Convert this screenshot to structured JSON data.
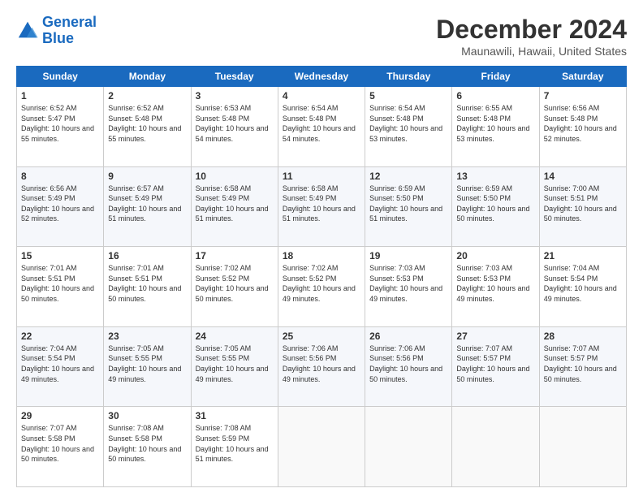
{
  "header": {
    "logo_line1": "General",
    "logo_line2": "Blue",
    "month_title": "December 2024",
    "location": "Maunawili, Hawaii, United States"
  },
  "days_of_week": [
    "Sunday",
    "Monday",
    "Tuesday",
    "Wednesday",
    "Thursday",
    "Friday",
    "Saturday"
  ],
  "weeks": [
    [
      {
        "day": "1",
        "sunrise": "6:52 AM",
        "sunset": "5:47 PM",
        "daylight": "10 hours and 55 minutes."
      },
      {
        "day": "2",
        "sunrise": "6:52 AM",
        "sunset": "5:48 PM",
        "daylight": "10 hours and 55 minutes."
      },
      {
        "day": "3",
        "sunrise": "6:53 AM",
        "sunset": "5:48 PM",
        "daylight": "10 hours and 54 minutes."
      },
      {
        "day": "4",
        "sunrise": "6:54 AM",
        "sunset": "5:48 PM",
        "daylight": "10 hours and 54 minutes."
      },
      {
        "day": "5",
        "sunrise": "6:54 AM",
        "sunset": "5:48 PM",
        "daylight": "10 hours and 53 minutes."
      },
      {
        "day": "6",
        "sunrise": "6:55 AM",
        "sunset": "5:48 PM",
        "daylight": "10 hours and 53 minutes."
      },
      {
        "day": "7",
        "sunrise": "6:56 AM",
        "sunset": "5:48 PM",
        "daylight": "10 hours and 52 minutes."
      }
    ],
    [
      {
        "day": "8",
        "sunrise": "6:56 AM",
        "sunset": "5:49 PM",
        "daylight": "10 hours and 52 minutes."
      },
      {
        "day": "9",
        "sunrise": "6:57 AM",
        "sunset": "5:49 PM",
        "daylight": "10 hours and 51 minutes."
      },
      {
        "day": "10",
        "sunrise": "6:58 AM",
        "sunset": "5:49 PM",
        "daylight": "10 hours and 51 minutes."
      },
      {
        "day": "11",
        "sunrise": "6:58 AM",
        "sunset": "5:49 PM",
        "daylight": "10 hours and 51 minutes."
      },
      {
        "day": "12",
        "sunrise": "6:59 AM",
        "sunset": "5:50 PM",
        "daylight": "10 hours and 51 minutes."
      },
      {
        "day": "13",
        "sunrise": "6:59 AM",
        "sunset": "5:50 PM",
        "daylight": "10 hours and 50 minutes."
      },
      {
        "day": "14",
        "sunrise": "7:00 AM",
        "sunset": "5:51 PM",
        "daylight": "10 hours and 50 minutes."
      }
    ],
    [
      {
        "day": "15",
        "sunrise": "7:01 AM",
        "sunset": "5:51 PM",
        "daylight": "10 hours and 50 minutes."
      },
      {
        "day": "16",
        "sunrise": "7:01 AM",
        "sunset": "5:51 PM",
        "daylight": "10 hours and 50 minutes."
      },
      {
        "day": "17",
        "sunrise": "7:02 AM",
        "sunset": "5:52 PM",
        "daylight": "10 hours and 50 minutes."
      },
      {
        "day": "18",
        "sunrise": "7:02 AM",
        "sunset": "5:52 PM",
        "daylight": "10 hours and 49 minutes."
      },
      {
        "day": "19",
        "sunrise": "7:03 AM",
        "sunset": "5:53 PM",
        "daylight": "10 hours and 49 minutes."
      },
      {
        "day": "20",
        "sunrise": "7:03 AM",
        "sunset": "5:53 PM",
        "daylight": "10 hours and 49 minutes."
      },
      {
        "day": "21",
        "sunrise": "7:04 AM",
        "sunset": "5:54 PM",
        "daylight": "10 hours and 49 minutes."
      }
    ],
    [
      {
        "day": "22",
        "sunrise": "7:04 AM",
        "sunset": "5:54 PM",
        "daylight": "10 hours and 49 minutes."
      },
      {
        "day": "23",
        "sunrise": "7:05 AM",
        "sunset": "5:55 PM",
        "daylight": "10 hours and 49 minutes."
      },
      {
        "day": "24",
        "sunrise": "7:05 AM",
        "sunset": "5:55 PM",
        "daylight": "10 hours and 49 minutes."
      },
      {
        "day": "25",
        "sunrise": "7:06 AM",
        "sunset": "5:56 PM",
        "daylight": "10 hours and 49 minutes."
      },
      {
        "day": "26",
        "sunrise": "7:06 AM",
        "sunset": "5:56 PM",
        "daylight": "10 hours and 50 minutes."
      },
      {
        "day": "27",
        "sunrise": "7:07 AM",
        "sunset": "5:57 PM",
        "daylight": "10 hours and 50 minutes."
      },
      {
        "day": "28",
        "sunrise": "7:07 AM",
        "sunset": "5:57 PM",
        "daylight": "10 hours and 50 minutes."
      }
    ],
    [
      {
        "day": "29",
        "sunrise": "7:07 AM",
        "sunset": "5:58 PM",
        "daylight": "10 hours and 50 minutes."
      },
      {
        "day": "30",
        "sunrise": "7:08 AM",
        "sunset": "5:58 PM",
        "daylight": "10 hours and 50 minutes."
      },
      {
        "day": "31",
        "sunrise": "7:08 AM",
        "sunset": "5:59 PM",
        "daylight": "10 hours and 51 minutes."
      },
      {
        "day": "",
        "sunrise": "",
        "sunset": "",
        "daylight": ""
      },
      {
        "day": "",
        "sunrise": "",
        "sunset": "",
        "daylight": ""
      },
      {
        "day": "",
        "sunrise": "",
        "sunset": "",
        "daylight": ""
      },
      {
        "day": "",
        "sunrise": "",
        "sunset": "",
        "daylight": ""
      }
    ]
  ]
}
